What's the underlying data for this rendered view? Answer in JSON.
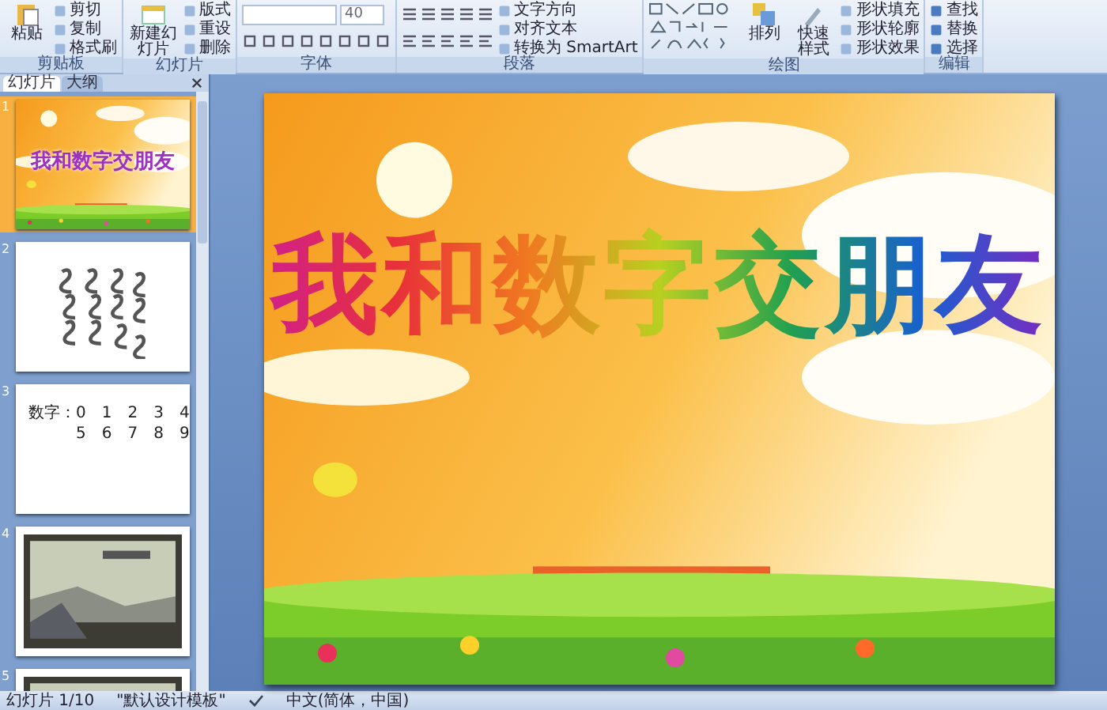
{
  "ribbon": {
    "groups": [
      {
        "label": "剪贴板",
        "kind": "clipboard",
        "large": [
          "粘贴"
        ],
        "small": [
          "剪切",
          "复制",
          "格式刷"
        ]
      },
      {
        "label": "幻灯片",
        "kind": "slides",
        "large": [
          "新建幻灯片"
        ],
        "small": [
          "版式",
          "重设",
          "删除"
        ]
      },
      {
        "label": "字体",
        "kind": "font",
        "font_size": "40"
      },
      {
        "label": "段落",
        "kind": "paragraph",
        "small": [
          "文字方向",
          "对齐文本",
          "转换为 SmartArt"
        ]
      },
      {
        "label": "绘图",
        "kind": "drawing",
        "large": [
          "排列",
          "快速样式"
        ],
        "small": [
          "形状填充",
          "形状轮廓",
          "形状效果"
        ]
      },
      {
        "label": "编辑",
        "kind": "editing",
        "small": [
          "查找",
          "替换",
          "选择"
        ]
      }
    ]
  },
  "pane_tabs": [
    {
      "label": "幻灯片",
      "selected": true
    },
    {
      "label": "大纲",
      "selected": false
    }
  ],
  "slides": [
    {
      "number": "1",
      "kind": "title",
      "selected": true,
      "title": "我和数字交朋友"
    },
    {
      "number": "2",
      "kind": "art",
      "selected": false
    },
    {
      "number": "3",
      "kind": "text",
      "selected": false,
      "lines": [
        "数字：0　1　2　3　4",
        "5　6　7　8　9"
      ]
    },
    {
      "number": "4",
      "selected": false
    },
    {
      "number": "5",
      "selected": false
    }
  ],
  "slide": {
    "title": "我和数字交朋友"
  },
  "status_bar": {
    "slide_count": "幻灯片 1/10",
    "theme": "\"默认设计模板\"",
    "language": "中文(简体，中国)"
  }
}
